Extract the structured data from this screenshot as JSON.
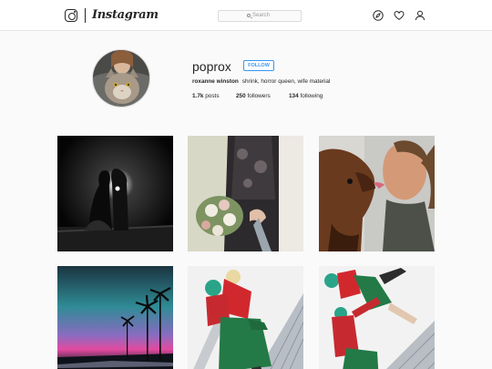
{
  "header": {
    "brand_name": "Instagram",
    "search": {
      "placeholder": "Search"
    },
    "icons": [
      "instagram-glyph-icon",
      "search-icon",
      "compass-icon",
      "heart-icon",
      "person-icon"
    ]
  },
  "profile": {
    "username": "poprox",
    "follow_label": "FOLLOW",
    "full_name": "roxanne winston",
    "bio": "shrink, horror queen, wife material",
    "stats": {
      "posts_count": "1.7k",
      "posts_label": "posts",
      "followers_count": "250",
      "followers_label": "followers",
      "following_count": "134",
      "following_label": "following"
    }
  },
  "colors": {
    "accent": "#3897f0",
    "text": "#262626",
    "background": "#fafafa",
    "border": "#dbdbdb"
  }
}
